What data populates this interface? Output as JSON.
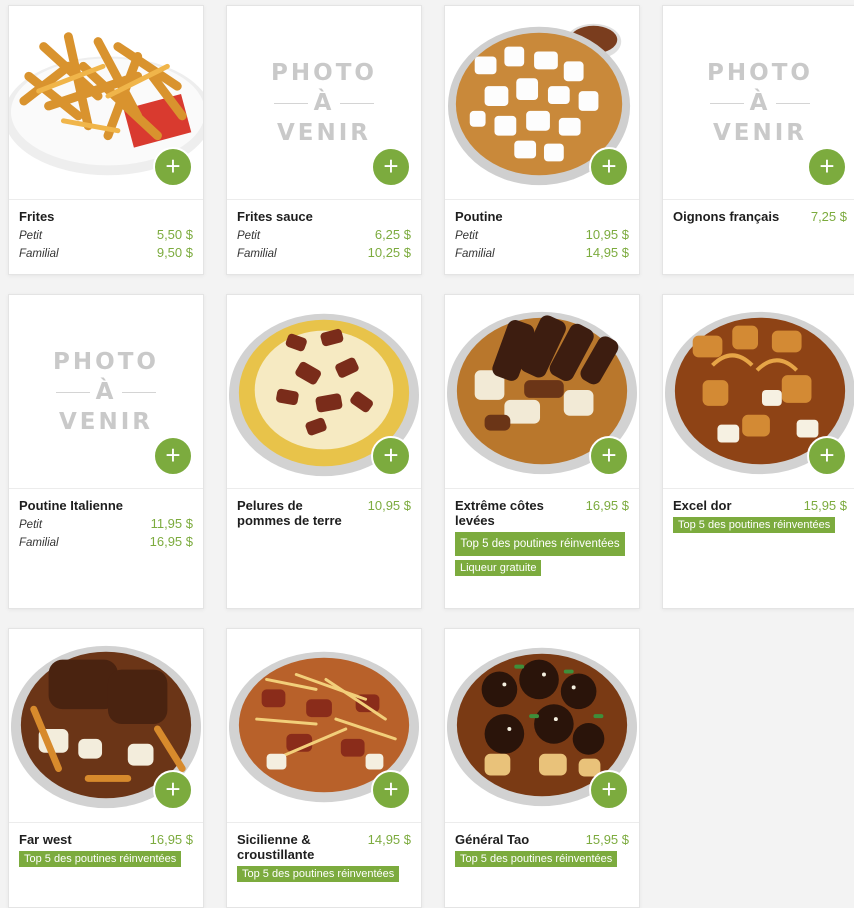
{
  "placeholder": {
    "line1": "PHOTO",
    "line2": "À",
    "line3": "VENIR"
  },
  "add_label": "+",
  "colors": {
    "accent": "#7cab3e",
    "text": "#1e1e1e"
  },
  "items": [
    {
      "name": "Frites",
      "sizes": [
        {
          "label": "Petit",
          "price": "5,50 $"
        },
        {
          "label": "Familial",
          "price": "9,50 $"
        }
      ]
    },
    {
      "name": "Frites sauce",
      "sizes": [
        {
          "label": "Petit",
          "price": "6,25 $"
        },
        {
          "label": "Familial",
          "price": "10,25 $"
        }
      ]
    },
    {
      "name": "Poutine",
      "sizes": [
        {
          "label": "Petit",
          "price": "10,95 $"
        },
        {
          "label": "Familial",
          "price": "14,95 $"
        }
      ]
    },
    {
      "name": "Oignons français",
      "price": "7,25 $"
    },
    {
      "name": "Poutine Italienne",
      "sizes": [
        {
          "label": "Petit",
          "price": "11,95 $"
        },
        {
          "label": "Familial",
          "price": "16,95 $"
        }
      ]
    },
    {
      "name": "Pelures de pommes de terre",
      "price": "10,95 $"
    },
    {
      "name": "Extrême côtes levées",
      "price": "16,95 $",
      "badges": [
        "Top 5 des poutines réinventées",
        "Liqueur gratuite"
      ]
    },
    {
      "name": "Excel dor",
      "price": "15,95 $",
      "badges": [
        "Top 5 des poutines réinventées"
      ]
    },
    {
      "name": "Far west",
      "price": "16,95 $",
      "badges": [
        "Top 5 des poutines réinventées"
      ]
    },
    {
      "name": "Sicilienne & croustillante",
      "price": "14,95 $",
      "badges": [
        "Top 5 des poutines réinventées"
      ]
    },
    {
      "name": "Général Tao",
      "price": "15,95 $",
      "badges": [
        "Top 5 des poutines réinventées"
      ]
    }
  ]
}
